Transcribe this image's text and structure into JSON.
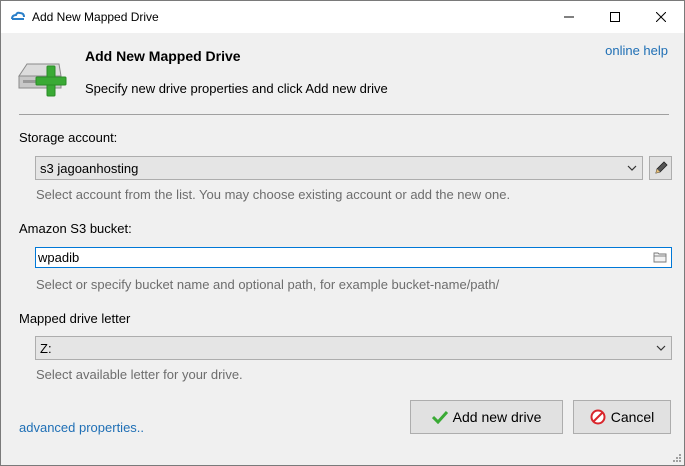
{
  "window": {
    "title": "Add New Mapped Drive",
    "controls": {
      "minimize": "minimize-icon",
      "maximize": "maximize-icon",
      "close": "close-icon"
    }
  },
  "header": {
    "title": "Add New Mapped Drive",
    "subtitle": "Specify new drive properties and click Add new drive",
    "online_help": "online help",
    "icon": "add-drive-icon"
  },
  "storage_account": {
    "label": "Storage account:",
    "value": "s3 jagoanhosting",
    "hint": "Select account from the list. You may choose existing account or add the new one.",
    "edit_icon": "pencil-icon"
  },
  "bucket": {
    "label": "Amazon S3 bucket:",
    "value": "wpadib",
    "hint": "Select or specify bucket name and optional path, for example bucket-name/path/",
    "browse_icon": "folder-icon"
  },
  "drive_letter": {
    "label": "Mapped drive letter",
    "value": "Z:",
    "hint": "Select available letter for your drive."
  },
  "footer": {
    "advanced_link": "advanced properties..",
    "add_button": "Add new drive",
    "cancel_button": "Cancel"
  },
  "colors": {
    "link": "#1f6fb5",
    "hint_text": "#6d6d6d",
    "focus_border": "#0078d7",
    "add_icon_green": "#3aaa35",
    "cancel_icon_red": "#d9262c"
  }
}
